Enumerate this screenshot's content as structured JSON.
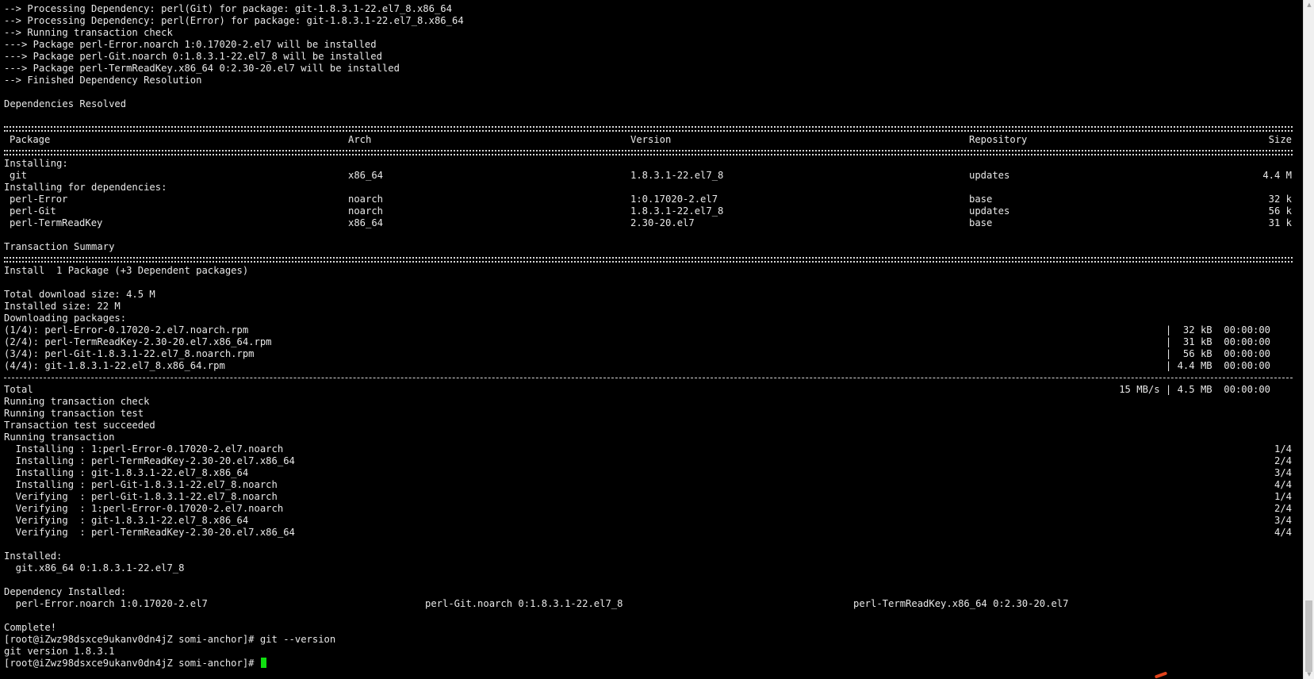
{
  "terminal": {
    "pre_lines": [
      "--> Processing Dependency: perl(Git) for package: git-1.8.3.1-22.el7_8.x86_64",
      "--> Processing Dependency: perl(Error) for package: git-1.8.3.1-22.el7_8.x86_64",
      "--> Running transaction check",
      "---> Package perl-Error.noarch 1:0.17020-2.el7 will be installed",
      "---> Package perl-Git.noarch 0:1.8.3.1-22.el7_8 will be installed",
      "---> Package perl-TermReadKey.x86_64 0:2.30-20.el7 will be installed",
      "--> Finished Dependency Resolution"
    ],
    "deps_resolved": "Dependencies Resolved",
    "table": {
      "headers": {
        "package": "Package",
        "arch": "Arch",
        "version": "Version",
        "repository": "Repository",
        "size": "Size"
      },
      "installing_label": "Installing:",
      "main_row": {
        "package": "git",
        "arch": "x86_64",
        "version": "1.8.3.1-22.el7_8",
        "repo": "updates",
        "size": "4.4 M"
      },
      "deps_label": "Installing for dependencies:",
      "dep_rows": [
        {
          "package": "perl-Error",
          "arch": "noarch",
          "version": "1:0.17020-2.el7",
          "repo": "base",
          "size": "32 k"
        },
        {
          "package": "perl-Git",
          "arch": "noarch",
          "version": "1.8.3.1-22.el7_8",
          "repo": "updates",
          "size": "56 k"
        },
        {
          "package": "perl-TermReadKey",
          "arch": "x86_64",
          "version": "2.30-20.el7",
          "repo": "base",
          "size": "31 k"
        }
      ]
    },
    "summary_title": "Transaction Summary",
    "install_summary": "Install  1 Package (+3 Dependent packages)",
    "download_size": "Total download size: 4.5 M",
    "installed_size": "Installed size: 22 M",
    "downloading": "Downloading packages:",
    "downloads": [
      {
        "name": "(1/4): perl-Error-0.17020-2.el7.noarch.rpm",
        "stat": "|  32 kB  00:00:00"
      },
      {
        "name": "(2/4): perl-TermReadKey-2.30-20.el7.x86_64.rpm",
        "stat": "|  31 kB  00:00:00"
      },
      {
        "name": "(3/4): perl-Git-1.8.3.1-22.el7_8.noarch.rpm",
        "stat": "|  56 kB  00:00:00"
      },
      {
        "name": "(4/4): git-1.8.3.1-22.el7_8.x86_64.rpm",
        "stat": "| 4.4 MB  00:00:00"
      }
    ],
    "total_label": "Total",
    "total_stat": "15 MB/s | 4.5 MB  00:00:00",
    "txn_lines": [
      "Running transaction check",
      "Running transaction test",
      "Transaction test succeeded",
      "Running transaction"
    ],
    "progress": [
      {
        "text": "  Installing : 1:perl-Error-0.17020-2.el7.noarch",
        "count": "1/4"
      },
      {
        "text": "  Installing : perl-TermReadKey-2.30-20.el7.x86_64",
        "count": "2/4"
      },
      {
        "text": "  Installing : git-1.8.3.1-22.el7_8.x86_64",
        "count": "3/4"
      },
      {
        "text": "  Installing : perl-Git-1.8.3.1-22.el7_8.noarch",
        "count": "4/4"
      },
      {
        "text": "  Verifying  : perl-Git-1.8.3.1-22.el7_8.noarch",
        "count": "1/4"
      },
      {
        "text": "  Verifying  : 1:perl-Error-0.17020-2.el7.noarch",
        "count": "2/4"
      },
      {
        "text": "  Verifying  : git-1.8.3.1-22.el7_8.x86_64",
        "count": "3/4"
      },
      {
        "text": "  Verifying  : perl-TermReadKey-2.30-20.el7.x86_64",
        "count": "4/4"
      }
    ],
    "installed_label": "Installed:",
    "installed_item": "  git.x86_64 0:1.8.3.1-22.el7_8",
    "dep_installed_label": "Dependency Installed:",
    "dep_installed_items": [
      "  perl-Error.noarch 1:0.17020-2.el7",
      "perl-Git.noarch 0:1.8.3.1-22.el7_8",
      "perl-TermReadKey.x86_64 0:2.30-20.el7"
    ],
    "complete": "Complete!",
    "command_line": "[root@iZwz98dsxce9ukanv0dn4jZ somi-anchor]# git --version",
    "version_output": "git version 1.8.3.1",
    "prompt": "[root@iZwz98dsxce9ukanv0dn4jZ somi-anchor]# "
  },
  "colors": {
    "background": "#000000",
    "text": "#e8e8e8",
    "cursor": "#10e010",
    "scrollbar": "#f0f0f0"
  }
}
